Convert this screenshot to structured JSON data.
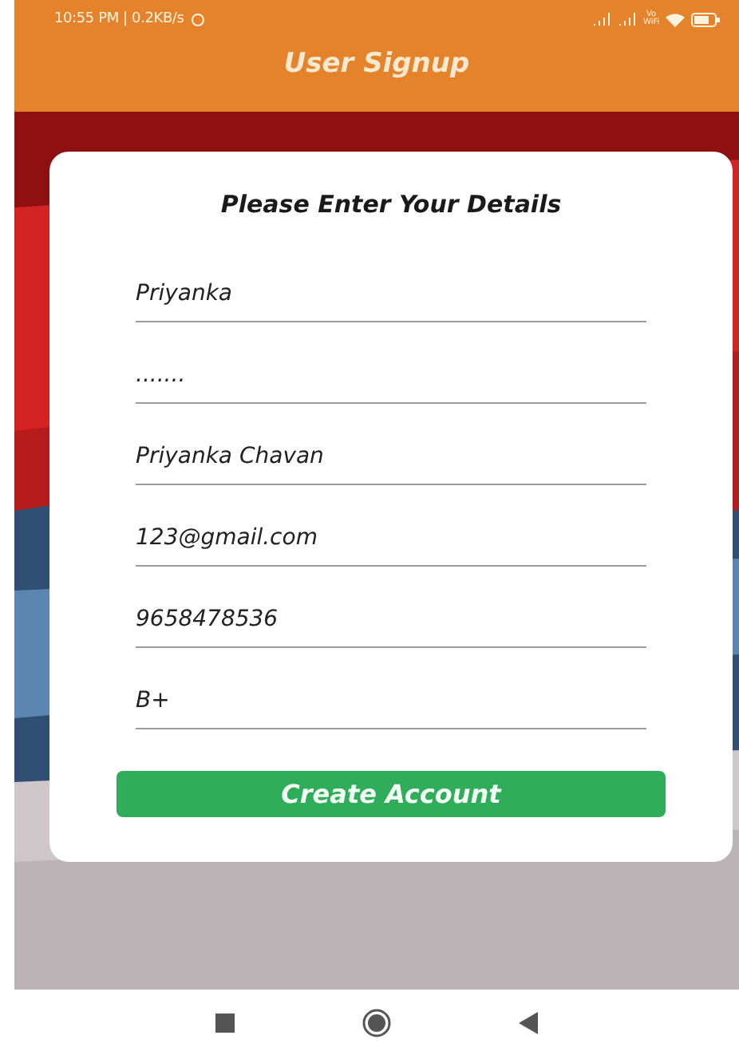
{
  "status_bar": {
    "time": "10:55 PM | 0.2KB/s",
    "network_label": "Vo WiFi"
  },
  "header": {
    "title": "User Signup"
  },
  "form": {
    "heading": "Please Enter Your Details",
    "fields": [
      {
        "value": "Priyanka"
      },
      {
        "value": "......."
      },
      {
        "value": "Priyanka Chavan"
      },
      {
        "value": "123@gmail.com"
      },
      {
        "value": "9658478536"
      },
      {
        "value": "B+"
      }
    ],
    "submit": "Create Account"
  }
}
